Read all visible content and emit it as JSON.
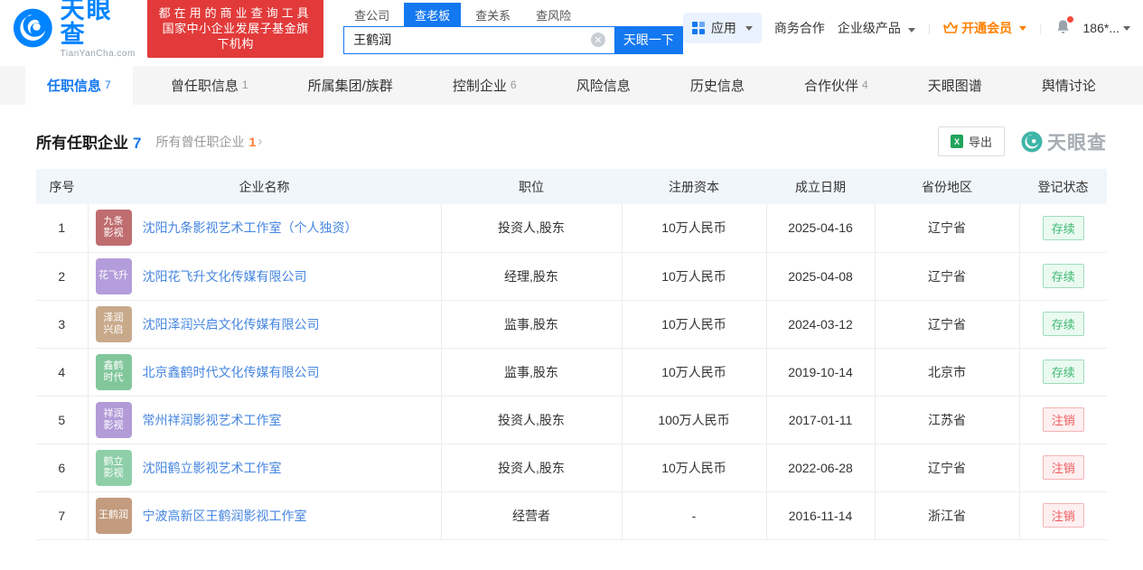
{
  "header": {
    "logo": {
      "brand": "天眼查",
      "domain": "TianYanCha.com"
    },
    "banner": {
      "line1": "都在用的商业查询工具",
      "line2": "国家中小企业发展子基金旗下机构"
    },
    "search": {
      "tabs": [
        {
          "label": "查公司",
          "active": false
        },
        {
          "label": "查老板",
          "active": true
        },
        {
          "label": "查关系",
          "active": false
        },
        {
          "label": "查风险",
          "active": false
        }
      ],
      "value": "王鹤润",
      "button": "天眼一下"
    },
    "nav": {
      "apps": "应用",
      "business": "商务合作",
      "enterprise": "企业级产品",
      "vip": "开通会员",
      "phone": "186*..."
    }
  },
  "page_tabs": [
    {
      "label": "任职信息",
      "count": "7",
      "active": true
    },
    {
      "label": "曾任职信息",
      "count": "1",
      "active": false
    },
    {
      "label": "所属集团/族群",
      "count": "",
      "active": false
    },
    {
      "label": "控制企业",
      "count": "6",
      "active": false
    },
    {
      "label": "风险信息",
      "count": "",
      "active": false
    },
    {
      "label": "历史信息",
      "count": "",
      "active": false
    },
    {
      "label": "合作伙伴",
      "count": "4",
      "active": false
    },
    {
      "label": "天眼图谱",
      "count": "",
      "active": false
    },
    {
      "label": "舆情讨论",
      "count": "",
      "active": false
    }
  ],
  "section": {
    "title": "所有任职企业",
    "title_count": "7",
    "subtitle": "所有曾任职企业",
    "subtitle_count": "1",
    "export_label": "导出",
    "watermark": "天眼查"
  },
  "table": {
    "headers": [
      "序号",
      "企业名称",
      "职位",
      "注册资本",
      "成立日期",
      "省份地区",
      "登记状态"
    ],
    "rows": [
      {
        "no": "1",
        "icon": [
          "九条",
          "影视"
        ],
        "icon_color": "#bf6d6f",
        "company": "沈阳九条影视艺术工作室（个人独资）",
        "position": "投资人,股东",
        "capital": "10万人民币",
        "date": "2025-04-16",
        "region": "辽宁省",
        "status": "存续",
        "status_type": "active"
      },
      {
        "no": "2",
        "icon": [
          "花飞升"
        ],
        "icon_color": "#b49ddb",
        "company": "沈阳花飞升文化传媒有限公司",
        "position": "经理,股东",
        "capital": "10万人民币",
        "date": "2025-04-08",
        "region": "辽宁省",
        "status": "存续",
        "status_type": "active"
      },
      {
        "no": "3",
        "icon": [
          "泽润",
          "兴启"
        ],
        "icon_color": "#c8aa8b",
        "company": "沈阳泽润兴启文化传媒有限公司",
        "position": "监事,股东",
        "capital": "10万人民币",
        "date": "2024-03-12",
        "region": "辽宁省",
        "status": "存续",
        "status_type": "active"
      },
      {
        "no": "4",
        "icon": [
          "鑫鹤",
          "时代"
        ],
        "icon_color": "#82c79c",
        "company": "北京鑫鹤时代文化传媒有限公司",
        "position": "监事,股东",
        "capital": "10万人民币",
        "date": "2019-10-14",
        "region": "北京市",
        "status": "存续",
        "status_type": "active"
      },
      {
        "no": "5",
        "icon": [
          "祥润",
          "影视"
        ],
        "icon_color": "#b39bd8",
        "company": "常州祥润影视艺术工作室",
        "position": "投资人,股东",
        "capital": "100万人民币",
        "date": "2017-01-11",
        "region": "江苏省",
        "status": "注销",
        "status_type": "cancelled"
      },
      {
        "no": "6",
        "icon": [
          "鹤立",
          "影视"
        ],
        "icon_color": "#8ecfa9",
        "company": "沈阳鹤立影视艺术工作室",
        "position": "投资人,股东",
        "capital": "10万人民币",
        "date": "2022-06-28",
        "region": "辽宁省",
        "status": "注销",
        "status_type": "cancelled"
      },
      {
        "no": "7",
        "icon": [
          "王鹤润"
        ],
        "icon_color": "#c39b7e",
        "company": "宁波高新区王鹤润影视工作室",
        "position": "经营者",
        "capital": "-",
        "date": "2016-11-14",
        "region": "浙江省",
        "status": "注销",
        "status_type": "cancelled"
      }
    ]
  },
  "colors": {
    "brand_blue": "#0084ff",
    "primary_blue": "#1478f0",
    "banner_red": "#e23a3a",
    "vip_orange": "#ff8000",
    "link_blue": "#4586e0",
    "status_active_green": "#3fb873",
    "status_cancelled_red": "#f05a5a",
    "orange_count": "#ff7733"
  }
}
